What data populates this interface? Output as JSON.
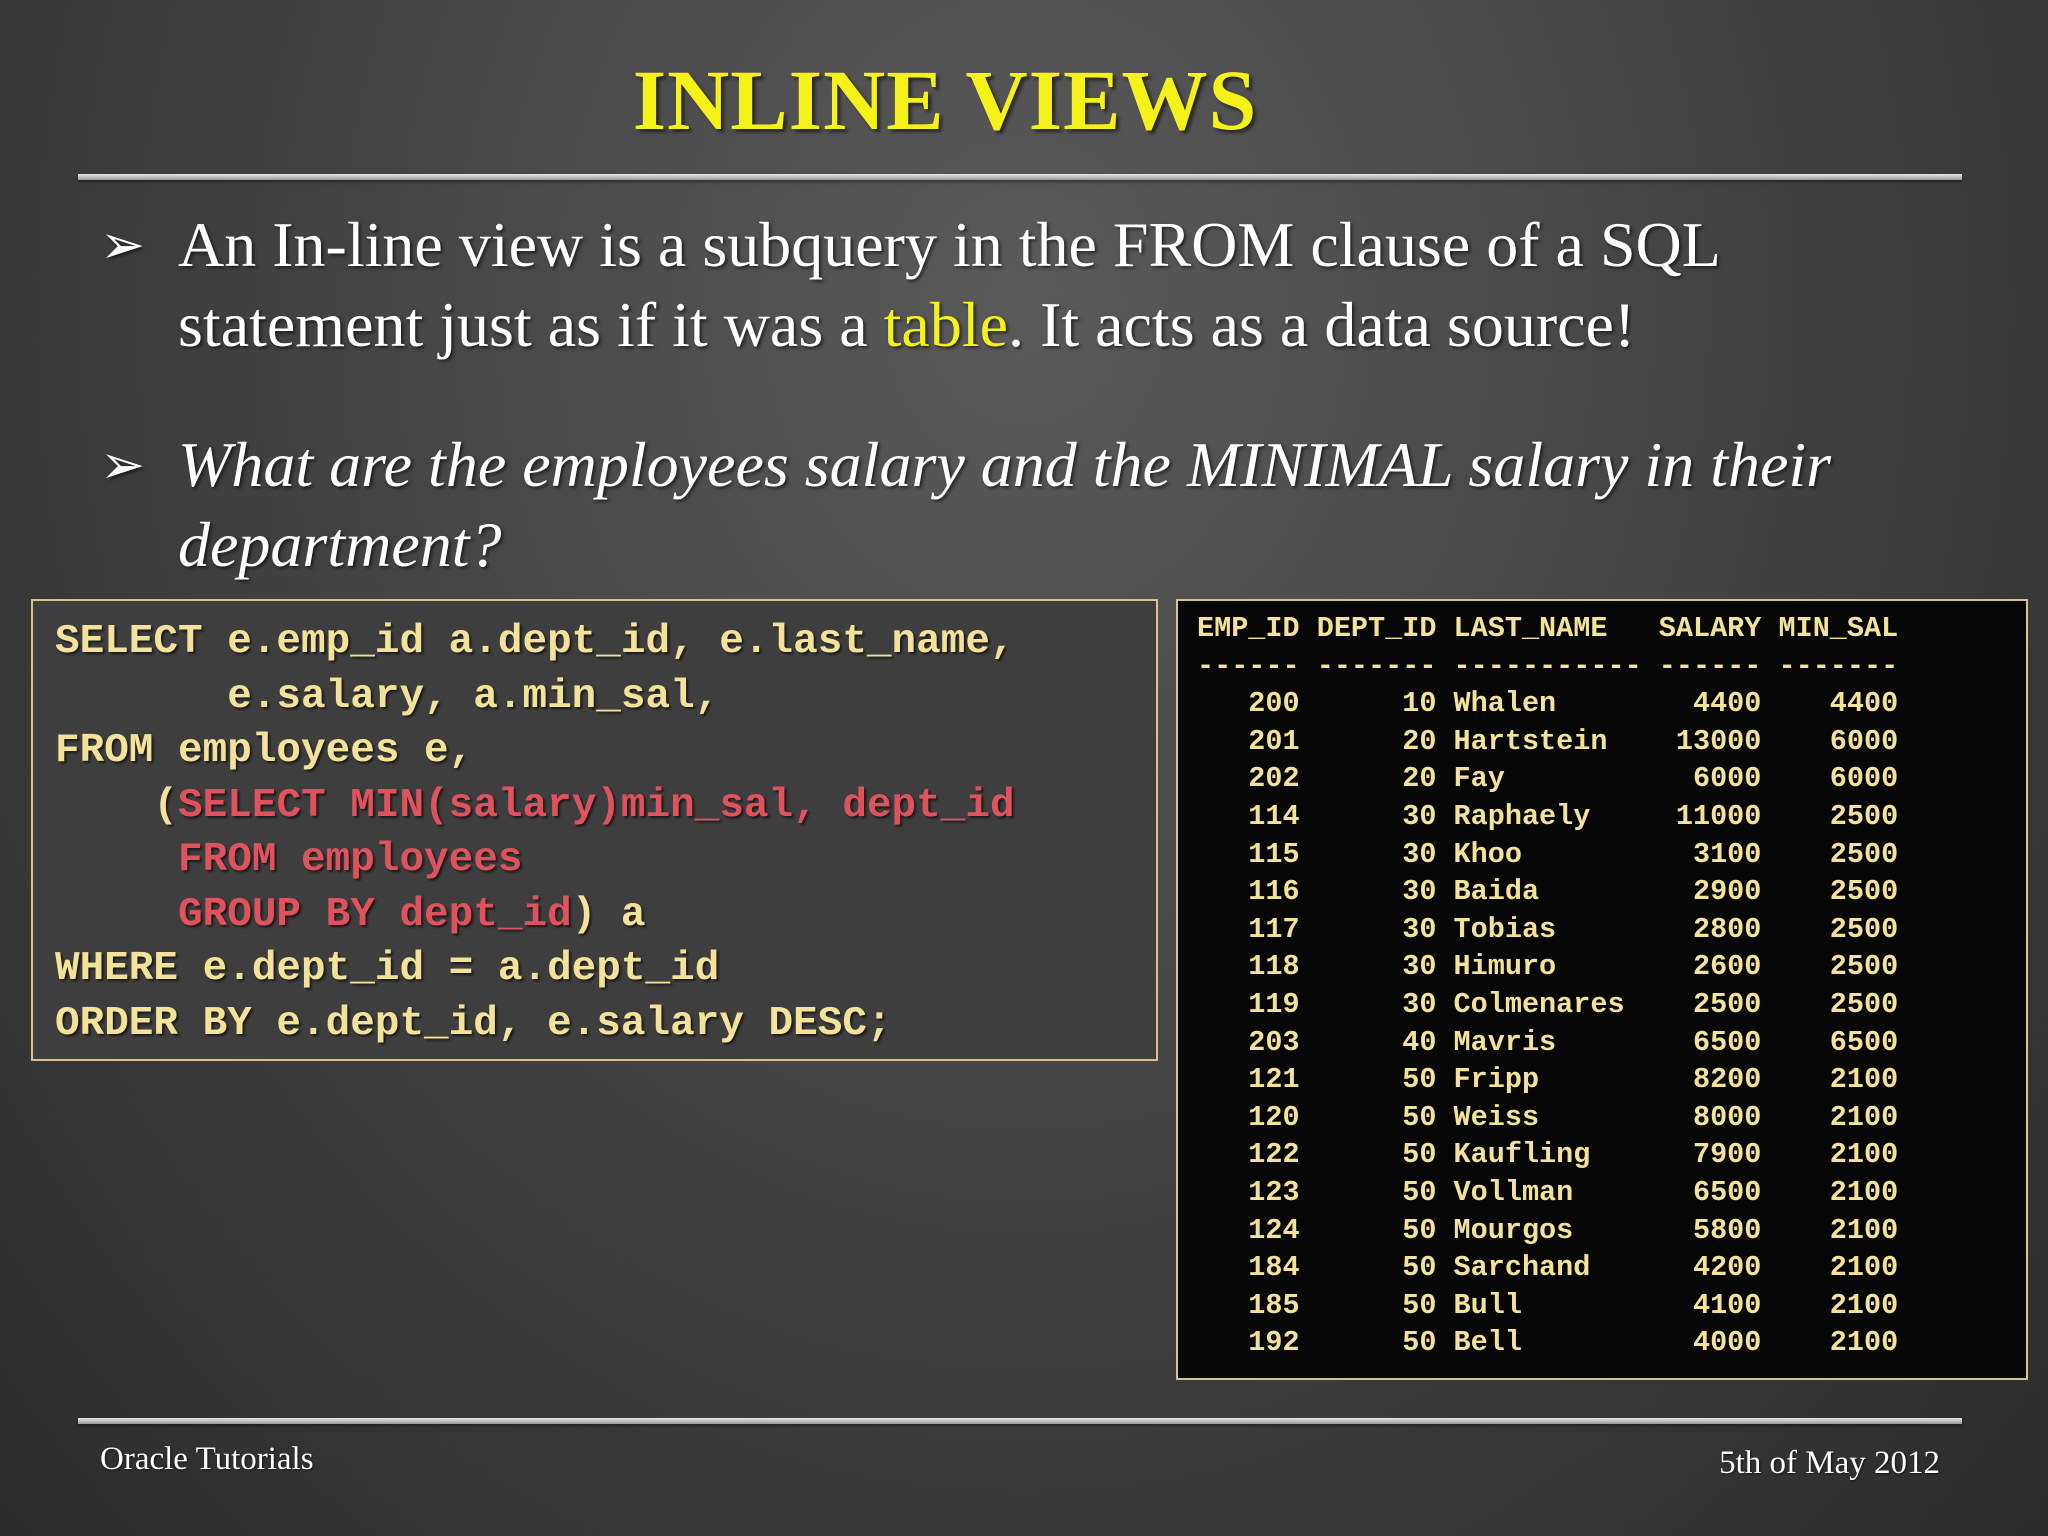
{
  "slide": {
    "title": "INLINE VIEWS",
    "bullets": [
      {
        "arrow": "➢",
        "line1": "An In-line view is a subquery in the FROM clause of a SQL",
        "line2_pre": "statement just as if it was a ",
        "line2_highlight": "table",
        "line2_post": ". It acts as a data source!"
      },
      {
        "arrow": "➢",
        "line1": "What are the employees salary and the MINIMAL salary in their",
        "line2": "department?"
      }
    ]
  },
  "code": {
    "l1": "SELECT e.emp_id a.dept_id, e.last_name,",
    "l2": "       e.salary, a.min_sal,",
    "l3": "FROM employees e,",
    "l4_open": "    (",
    "l4_sub": "SELECT MIN(salary)min_sal, dept_id",
    "l5_sub": "     FROM employees",
    "l6_sub": "     GROUP BY dept_id",
    "l6_close": ") a",
    "l7": "WHERE e.dept_id = a.dept_id",
    "l8": "ORDER BY e.dept_id, e.salary DESC;"
  },
  "result": {
    "header": "EMP_ID DEPT_ID LAST_NAME   SALARY MIN_SAL",
    "separator": "------ ------- ----------- ------ -------",
    "rows": [
      {
        "emp_id": "200",
        "dept_id": "10",
        "last_name": "Whalen",
        "salary": "4400",
        "min_sal": "4400"
      },
      {
        "emp_id": "201",
        "dept_id": "20",
        "last_name": "Hartstein",
        "salary": "13000",
        "min_sal": "6000"
      },
      {
        "emp_id": "202",
        "dept_id": "20",
        "last_name": "Fay",
        "salary": "6000",
        "min_sal": "6000"
      },
      {
        "emp_id": "114",
        "dept_id": "30",
        "last_name": "Raphaely",
        "salary": "11000",
        "min_sal": "2500"
      },
      {
        "emp_id": "115",
        "dept_id": "30",
        "last_name": "Khoo",
        "salary": "3100",
        "min_sal": "2500"
      },
      {
        "emp_id": "116",
        "dept_id": "30",
        "last_name": "Baida",
        "salary": "2900",
        "min_sal": "2500"
      },
      {
        "emp_id": "117",
        "dept_id": "30",
        "last_name": "Tobias",
        "salary": "2800",
        "min_sal": "2500"
      },
      {
        "emp_id": "118",
        "dept_id": "30",
        "last_name": "Himuro",
        "salary": "2600",
        "min_sal": "2500"
      },
      {
        "emp_id": "119",
        "dept_id": "30",
        "last_name": "Colmenares",
        "salary": "2500",
        "min_sal": "2500"
      },
      {
        "emp_id": "203",
        "dept_id": "40",
        "last_name": "Mavris",
        "salary": "6500",
        "min_sal": "6500"
      },
      {
        "emp_id": "121",
        "dept_id": "50",
        "last_name": "Fripp",
        "salary": "8200",
        "min_sal": "2100"
      },
      {
        "emp_id": "120",
        "dept_id": "50",
        "last_name": "Weiss",
        "salary": "8000",
        "min_sal": "2100"
      },
      {
        "emp_id": "122",
        "dept_id": "50",
        "last_name": "Kaufling",
        "salary": "7900",
        "min_sal": "2100"
      },
      {
        "emp_id": "123",
        "dept_id": "50",
        "last_name": "Vollman",
        "salary": "6500",
        "min_sal": "2100"
      },
      {
        "emp_id": "124",
        "dept_id": "50",
        "last_name": "Mourgos",
        "salary": "5800",
        "min_sal": "2100"
      },
      {
        "emp_id": "184",
        "dept_id": "50",
        "last_name": "Sarchand",
        "salary": "4200",
        "min_sal": "2100"
      },
      {
        "emp_id": "185",
        "dept_id": "50",
        "last_name": "Bull",
        "salary": "4100",
        "min_sal": "2100"
      },
      {
        "emp_id": "192",
        "dept_id": "50",
        "last_name": "Bell",
        "salary": "4000",
        "min_sal": "2100"
      }
    ]
  },
  "footer": {
    "left": "Oracle Tutorials",
    "right": "5th of May 2012"
  }
}
